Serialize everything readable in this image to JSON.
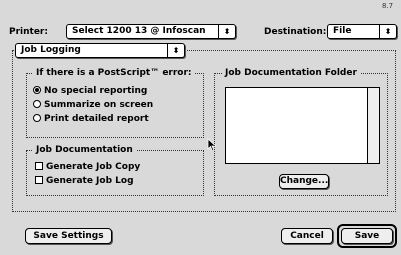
{
  "version": "8.7",
  "printer": {
    "label": "Printer:",
    "value": "Select 1200 13 @ Infoscan"
  },
  "destination": {
    "label": "Destination:",
    "value": "File"
  },
  "panel_menu": {
    "value": "Job Logging"
  },
  "postscript_error": {
    "legend": "If there is a PostScript™ error:",
    "options": [
      {
        "label": "No special reporting",
        "selected": true
      },
      {
        "label": "Summarize on screen",
        "selected": false
      },
      {
        "label": "Print detailed report",
        "selected": false
      }
    ]
  },
  "job_documentation": {
    "legend": "Job Documentation",
    "options": [
      {
        "label": "Generate Job Copy",
        "checked": false
      },
      {
        "label": "Generate Job Log",
        "checked": false
      }
    ]
  },
  "folder": {
    "legend": "Job Documentation Folder",
    "change_label": "Change..."
  },
  "buttons": {
    "save_settings": "Save Settings",
    "cancel": "Cancel",
    "save": "Save"
  }
}
